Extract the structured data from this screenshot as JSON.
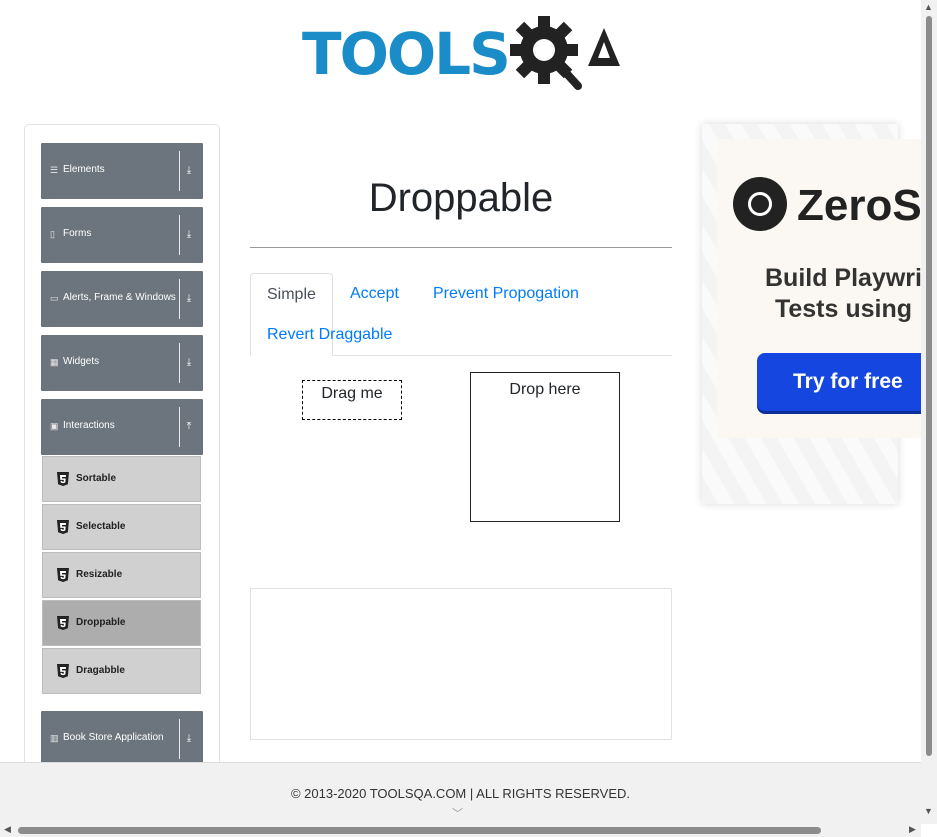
{
  "header": {
    "logo_text": "TOOLS",
    "logo_text_2": "QA"
  },
  "sidebar": {
    "groups": [
      {
        "label": "Elements",
        "icon": "list-icon"
      },
      {
        "label": "Forms",
        "icon": "form-icon"
      },
      {
        "label": "Alerts, Frame & Windows",
        "icon": "window-icon"
      },
      {
        "label": "Widgets",
        "icon": "grid-icon"
      },
      {
        "label": "Interactions",
        "icon": "interaction-icon"
      },
      {
        "label": "Book Store Application",
        "icon": "bar-chart-icon"
      }
    ],
    "interactions_items": [
      {
        "label": "Sortable"
      },
      {
        "label": "Selectable"
      },
      {
        "label": "Resizable"
      },
      {
        "label": "Droppable"
      },
      {
        "label": "Dragabble"
      }
    ]
  },
  "main": {
    "title": "Droppable",
    "tabs": [
      {
        "label": "Simple"
      },
      {
        "label": "Accept"
      },
      {
        "label": "Prevent Propogation"
      },
      {
        "label": "Revert Draggable"
      }
    ],
    "drag_label": "Drag me",
    "drop_label": "Drop here"
  },
  "ad": {
    "brand": "ZeroSt",
    "headline_1": "Build Playwri",
    "headline_2": "Tests using",
    "cta": "Try for free"
  },
  "footer": {
    "text": "© 2013-2020 TOOLSQA.COM | ALL RIGHTS RESERVED."
  },
  "colors": {
    "accent": "#1a8cc7",
    "link": "#007bff",
    "sidebar_group": "#6c757d",
    "ad_button": "#1646e0"
  }
}
